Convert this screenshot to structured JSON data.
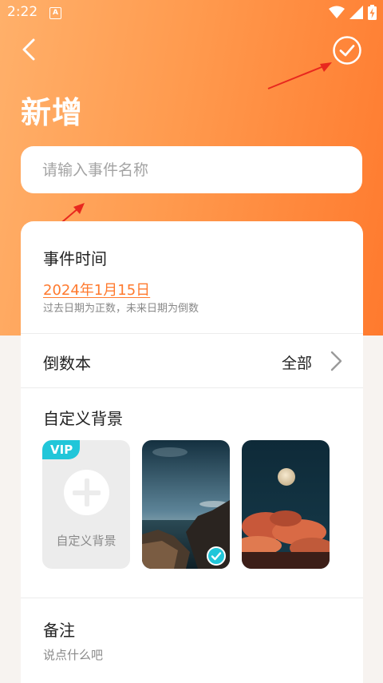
{
  "status_bar": {
    "time": "2:22",
    "app_badge": "A",
    "icons": [
      "wifi-icon",
      "signal-icon",
      "battery-charging-icon"
    ]
  },
  "nav": {
    "back_icon": "chevron-left-icon",
    "confirm_icon": "check-circle-icon"
  },
  "page": {
    "title": "新增"
  },
  "event_name": {
    "placeholder": "请输入事件名称",
    "value": ""
  },
  "event_time": {
    "label": "事件时间",
    "date": "2024年1月15日",
    "hint": "过去日期为正数，未来日期为倒数"
  },
  "countdown_book": {
    "label": "倒数本",
    "value": "全部",
    "icon": "chevron-right-icon"
  },
  "custom_background": {
    "label": "自定义背景",
    "tiles": [
      {
        "type": "custom",
        "badge": "VIP",
        "label": "自定义背景",
        "icon": "plus-icon",
        "selected": false
      },
      {
        "type": "image",
        "scene": "sea-cliff-dusk",
        "selected": true
      },
      {
        "type": "image",
        "scene": "full-moon-clouds",
        "selected": false
      }
    ]
  },
  "notes": {
    "label": "备注",
    "placeholder": "说点什么吧"
  },
  "colors": {
    "accent": "#ff7a2e",
    "header_gradient_start": "#ffb06a",
    "header_gradient_end": "#ff7a2e",
    "vip": "#21c6d9",
    "annotation_arrow": "#e8281e"
  }
}
